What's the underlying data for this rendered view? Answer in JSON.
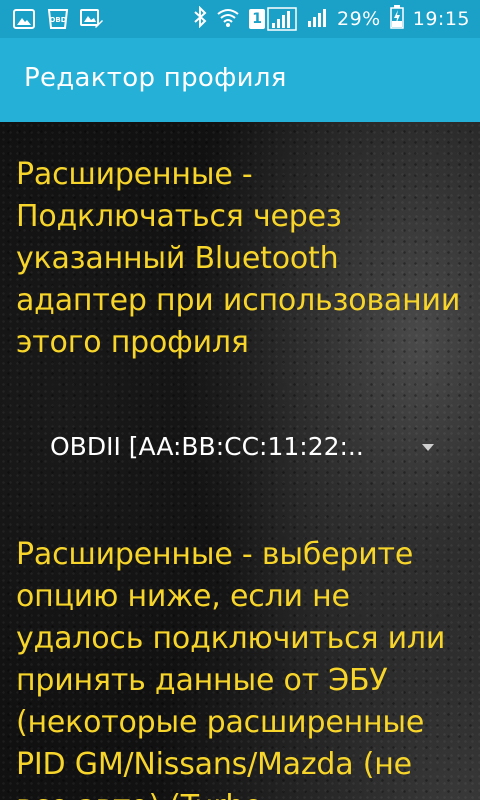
{
  "status_bar": {
    "battery_percent": "29%",
    "time": "19:15",
    "sim_slot": "1",
    "icons": [
      "gallery-icon",
      "obd-icon",
      "screenshot-edit-icon",
      "bluetooth-icon",
      "wifi-icon",
      "sim1-signal-icon",
      "signal-icon",
      "battery-charging-icon"
    ],
    "obd_badge": "OBD"
  },
  "app_bar": {
    "title": "Редактор профиля"
  },
  "preferences": {
    "bluetooth_pref": {
      "text": "Расширенные - Подключаться через указанный Bluetooth адаптер при использовании этого профиля"
    },
    "adapter_select": {
      "selected": "OBDII [AA:BB:CC:11:22:.."
    },
    "fallback_pref": {
      "text": "Расширенные - выберите опцию ниже, если не удалось подключиться или принять данные от ЭБУ (некоторые расширенные PID GM/Nissans/Mazda (не все авто) (Turbo"
    }
  },
  "colors": {
    "status_bar": "#1ba0c8",
    "app_bar": "#25b0d8",
    "pref_text": "#f7d52a",
    "spinner_text": "#ffffff"
  }
}
